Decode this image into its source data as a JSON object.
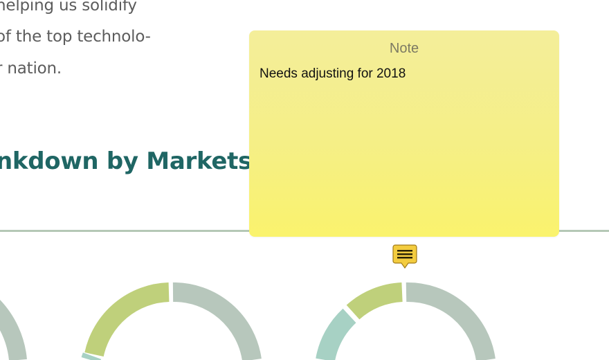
{
  "article": {
    "paragraph_lines": [
      "helping us solidify",
      "of the top technolo-",
      "r nation."
    ],
    "heading": "nkdown by Markets"
  },
  "note": {
    "title": "Note",
    "text": "Needs adjusting for 2018",
    "marker_icon": "note-lines-icon"
  },
  "colors": {
    "heading": "#1f6664",
    "body_text": "#5c5c5c",
    "divider": "#b5c8b6",
    "donut_gray": "#b7c7bc",
    "donut_green": "#bfd07b",
    "donut_teal": "#a7d1c4",
    "note_yellow": "#f7f07f",
    "marker_yellow": "#f3cc3f"
  },
  "donuts": [
    {
      "segments": [
        {
          "color": "gray",
          "share": 0.55
        }
      ]
    },
    {
      "segments": [
        {
          "color": "gray",
          "share": 0.5
        },
        {
          "color": "teal",
          "share": 0.05
        },
        {
          "color": "green",
          "share": 0.2
        }
      ]
    },
    {
      "segments": [
        {
          "color": "gray",
          "share": 0.5
        },
        {
          "color": "teal",
          "share": 0.17
        },
        {
          "color": "green",
          "share": 0.11
        }
      ]
    }
  ]
}
